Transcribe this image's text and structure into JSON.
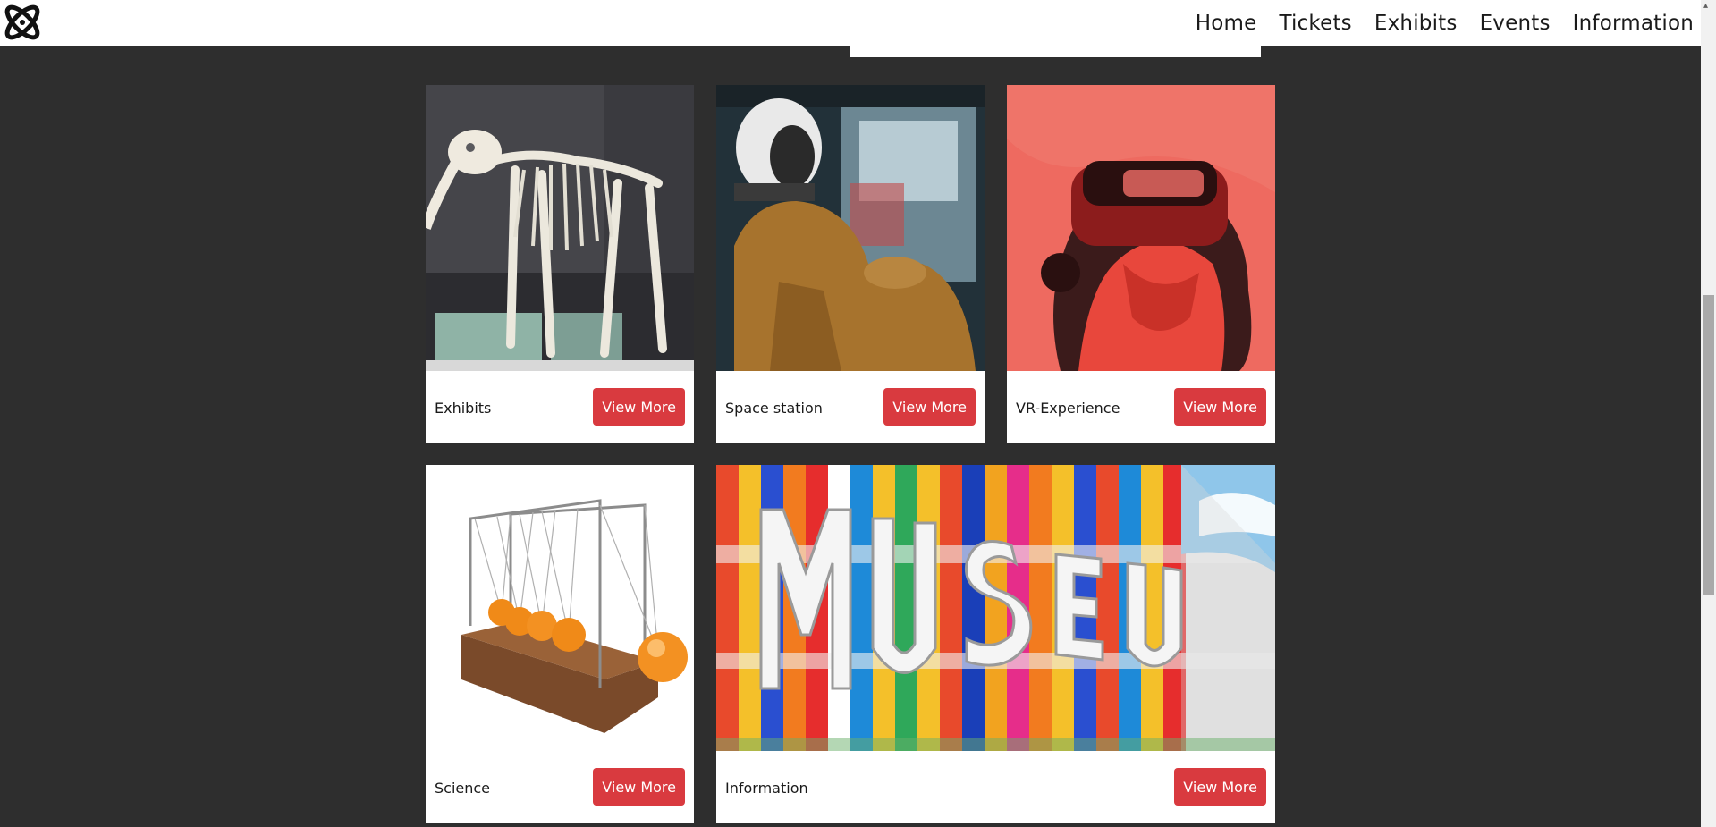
{
  "nav": {
    "logo_icon": "atom-icon",
    "links": [
      "Home",
      "Tickets",
      "Exhibits",
      "Events",
      "Information"
    ]
  },
  "cards": [
    {
      "label": "Exhibits",
      "button": "View More",
      "image": "dinosaur-skeleton-photo"
    },
    {
      "label": "Space station",
      "button": "View More",
      "image": "astronaut-cockpit-photo"
    },
    {
      "label": "VR-Experience",
      "button": "View More",
      "image": "vr-headset-photo"
    },
    {
      "label": "Science",
      "button": "View More",
      "image": "newtons-cradle-photo"
    },
    {
      "label": "Information",
      "button": "View More",
      "image": "museum-facade-photo"
    }
  ],
  "colors": {
    "accent": "#d93a3f",
    "background": "#2e2e2e",
    "navbar": "#ffffff"
  }
}
